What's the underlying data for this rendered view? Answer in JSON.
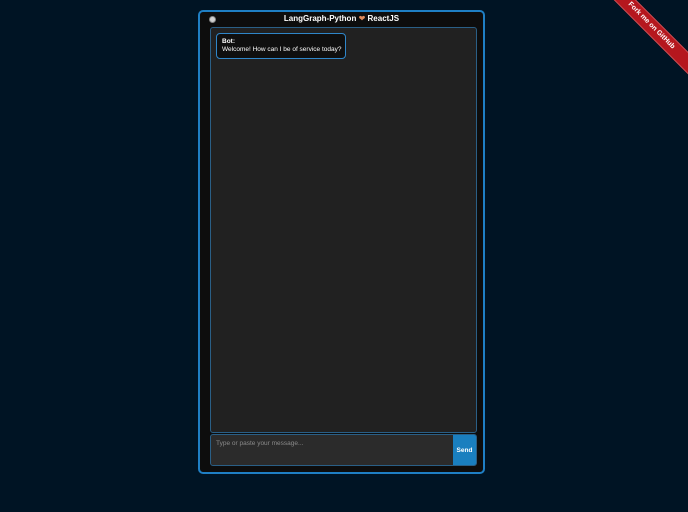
{
  "ribbon": {
    "label": "Fork me on GitHub"
  },
  "header": {
    "title_left": "LangGraph-Python",
    "title_icon": "heart-emoji",
    "title_right": "ReactJS"
  },
  "messages": [
    {
      "sender": "Bot:",
      "text": "Welcome! How can I be of service today?"
    }
  ],
  "composer": {
    "placeholder": "Type or paste your message...",
    "value": "",
    "send_label": "Send"
  },
  "colors": {
    "page_background": "#001424",
    "accent": "#1a7fbf",
    "ribbon": "#b5171e"
  }
}
